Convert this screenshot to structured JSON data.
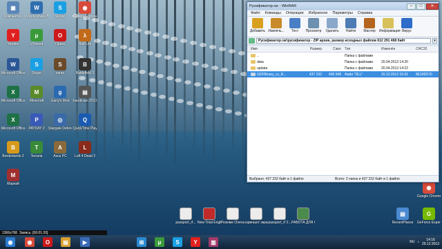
{
  "window": {
    "title": "Русификатор.rar\\русификатор - ZIP архив, размер исходных файлов 612 291 468 байт",
    "title_short": "Русификатор.rar - WinRAR",
    "minimize": "–",
    "maximize": "□",
    "close": "✕"
  },
  "menu": [
    "Файл",
    "Команды",
    "Операции",
    "Избранное",
    "Параметры",
    "Справка"
  ],
  "toolbar": [
    {
      "label": "Добавить",
      "color": "#d9a020"
    },
    {
      "label": "Извлечь...",
      "color": "#c88a2a"
    },
    {
      "label": "Тест",
      "color": "#4a7fc6"
    },
    {
      "label": "Просмотр",
      "color": "#6d8fb0"
    },
    {
      "label": "Удалить",
      "color": "#8aa8c9"
    },
    {
      "label": "Найти",
      "color": "#4d7bb4"
    },
    {
      "label": "Мастер",
      "color": "#b5651d"
    },
    {
      "label": "Информация",
      "color": "#d8c15a"
    },
    {
      "label": "Вирус",
      "color": "#2d6cc8"
    }
  ],
  "address": "Русификатор.rar\\русификатор - ZIP архив, размер исходных файлов 612 291 468 байт",
  "columns": {
    "name": "Имя",
    "size": "Размер",
    "packed": "Сжат",
    "type": "Тип",
    "modified": "Изменён",
    "crc": "CRC32"
  },
  "rows": [
    {
      "name": "..",
      "size": "",
      "packed": "",
      "type": "Папка с файлами",
      "modified": "",
      "crc": "",
      "selected": false,
      "kind": "folder"
    },
    {
      "name": "data",
      "size": "",
      "packed": "",
      "type": "Папка с файлами",
      "modified": "20.04.2013 14:20",
      "crc": "",
      "selected": false,
      "kind": "folder"
    },
    {
      "name": "updata",
      "size": "",
      "packed": "",
      "type": "Папка с файлами",
      "modified": "20.04.2013 14:22",
      "crc": "",
      "selected": false,
      "kind": "folder"
    },
    {
      "name": "GDFBinary_ru_R...",
      "size": "437 232",
      "packed": "400 948",
      "type": "Файл \"DLL\"",
      "modified": "20.12.2012 10:41",
      "crc": "8E18D570",
      "selected": true,
      "kind": "dll"
    }
  ],
  "status": {
    "selected": "Выбрано: 437 232 байт в 1 файле",
    "total": "Всего: 2 папок и 437 232 байт в 1 файле"
  },
  "desktop_icons": [
    {
      "label": "Компьютер",
      "color": "#5a86b8",
      "glyph": "▣"
    },
    {
      "label": "Wondershare Book Zaw",
      "color": "#2f6fb0",
      "glyph": "W"
    },
    {
      "label": "Skype",
      "color": "#1a9fe3",
      "glyph": "S"
    },
    {
      "label": "Google Chrome",
      "color": "#d84a3a",
      "glyph": "◉"
    },
    {
      "label": "Yandex",
      "color": "#e02020",
      "glyph": "Y"
    },
    {
      "label": "uTorrent",
      "color": "#3a9a3a",
      "glyph": "μ"
    },
    {
      "label": "Opera",
      "color": "#cc1a1a",
      "glyph": "O"
    },
    {
      "label": "Half-Life",
      "color": "#c06a1a",
      "glyph": "λ"
    },
    {
      "label": "Microsoft Office Word",
      "color": "#2b5797",
      "glyph": "W"
    },
    {
      "label": "Skype",
      "color": "#1a9fe3",
      "glyph": "S"
    },
    {
      "label": "samp",
      "color": "#6a4a2a",
      "glyph": "S"
    },
    {
      "label": "Battlefield 3",
      "color": "#333",
      "glyph": "B"
    },
    {
      "label": "Microsoft Office Excel",
      "color": "#1e7145",
      "glyph": "X"
    },
    {
      "label": "Minecraft",
      "color": "#5a8a2a",
      "glyph": "M"
    },
    {
      "label": "Garry's Mod",
      "color": "#2a6ab0",
      "glyph": "g"
    },
    {
      "label": "bandicam 2013-12-29",
      "color": "#555",
      "glyph": "▤"
    },
    {
      "label": "Microsoft Office Excel",
      "color": "#1e7145",
      "glyph": "X"
    },
    {
      "label": "PAYDAY 2",
      "color": "#3a5ab8",
      "glyph": "P"
    },
    {
      "label": "Stargate Defender",
      "color": "#3a6aa8",
      "glyph": "◎"
    },
    {
      "label": "QuickTime Player",
      "color": "#1a5ab0",
      "glyph": "Q"
    },
    {
      "label": "Borderlands 2",
      "color": "#d89a1a",
      "glyph": "B"
    },
    {
      "label": "Terraria",
      "color": "#3a8a3a",
      "glyph": "T"
    },
    {
      "label": "Asus PC",
      "color": "#8a6a3a",
      "glyph": "A"
    },
    {
      "label": "Left 4 Dead 2",
      "color": "#8a2a1a",
      "glyph": "L"
    },
    {
      "label": "Маркай",
      "color": "#a03030",
      "glyph": "M"
    }
  ],
  "bottom_files": [
    {
      "label": "passport_rf...",
      "color": "#ececec"
    },
    {
      "label": "New Total English E...",
      "color": "#c02a2a"
    },
    {
      "label": "Резюме Олега тех...",
      "color": "#ececec"
    },
    {
      "label": "скриншот экрана ...",
      "color": "#ececec"
    },
    {
      "label": "passport_rf 2...",
      "color": "#ececec"
    },
    {
      "label": "РАБОТА ДЛЯ ОЛЕГА",
      "color": "#4a8a4a"
    }
  ],
  "right_icons": [
    {
      "label": "Google Chrome",
      "color": "#d84a3a",
      "glyph": "◉"
    },
    {
      "label": "RecentPlaces",
      "color": "#4a8ad0",
      "glyph": "▤"
    },
    {
      "label": "GeForce Experience",
      "color": "#76b900",
      "glyph": "G"
    }
  ],
  "taskbar_icons": [
    {
      "name": "start",
      "color": "#2a7ad0",
      "glyph": "◉"
    },
    {
      "name": "chrome",
      "color": "#d84a3a",
      "glyph": "◉"
    },
    {
      "name": "opera",
      "color": "#cc1a1a",
      "glyph": "O"
    },
    {
      "name": "explorer",
      "color": "#d8a030",
      "glyph": "▤"
    },
    {
      "name": "media",
      "color": "#3a6ab8",
      "glyph": "▶"
    },
    {
      "name": "windows",
      "color": "#2a8ad0",
      "glyph": "⊞"
    },
    {
      "name": "utorrent",
      "color": "#3a9a3a",
      "glyph": "μ"
    },
    {
      "name": "skype",
      "color": "#1a9fe3",
      "glyph": "S"
    },
    {
      "name": "yandex",
      "color": "#e02020",
      "glyph": "Y"
    },
    {
      "name": "winrar",
      "color": "#a03a6a",
      "glyph": "▥"
    }
  ],
  "recorder": {
    "resolution": "1366x768",
    "rec": "Запись: [00:01:20]"
  },
  "tray": {
    "lang": "RU",
    "time": "14:16",
    "date": "29.12.2013"
  }
}
